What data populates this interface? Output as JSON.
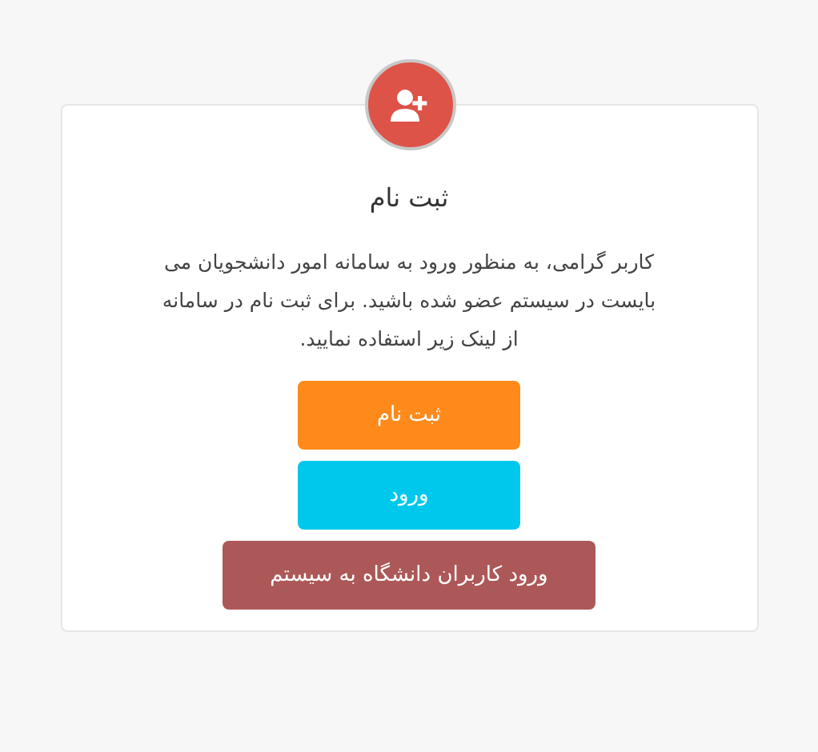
{
  "card": {
    "title": "ثبت نام",
    "message": "کاربر گرامی، به منظور ورود به سامانه امور دانشجویان می بایست در سیستم عضو شده باشید. برای ثبت نام در سامانه از لینک زیر استفاده نمایید.",
    "buttons": [
      {
        "label": "ثبت نام",
        "color": "#fe8a1b",
        "kind": "narrow"
      },
      {
        "label": "ورود",
        "color": "#00c8ed",
        "kind": "narrow"
      },
      {
        "label": "ورود کاربران دانشگاه به سیستم",
        "color": "#ad5858",
        "kind": "wide"
      }
    ]
  }
}
